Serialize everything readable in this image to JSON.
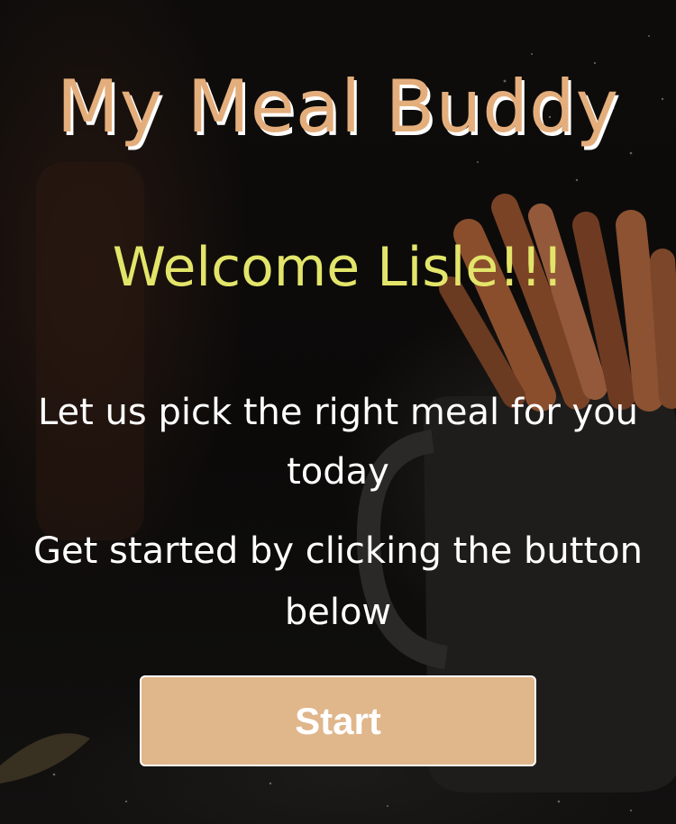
{
  "app": {
    "title": "My Meal Buddy"
  },
  "greeting": {
    "text": "Welcome Lisle!!!"
  },
  "intro": {
    "line1": "Let us pick the right meal for you today",
    "line2": "Get started by clicking the button below"
  },
  "actions": {
    "start_label": "Start"
  },
  "colors": {
    "title": "#e4ae7c",
    "greeting": "#e3e56a",
    "button": "#e0b68b",
    "text": "#ffffff",
    "background": "#0b0908"
  }
}
